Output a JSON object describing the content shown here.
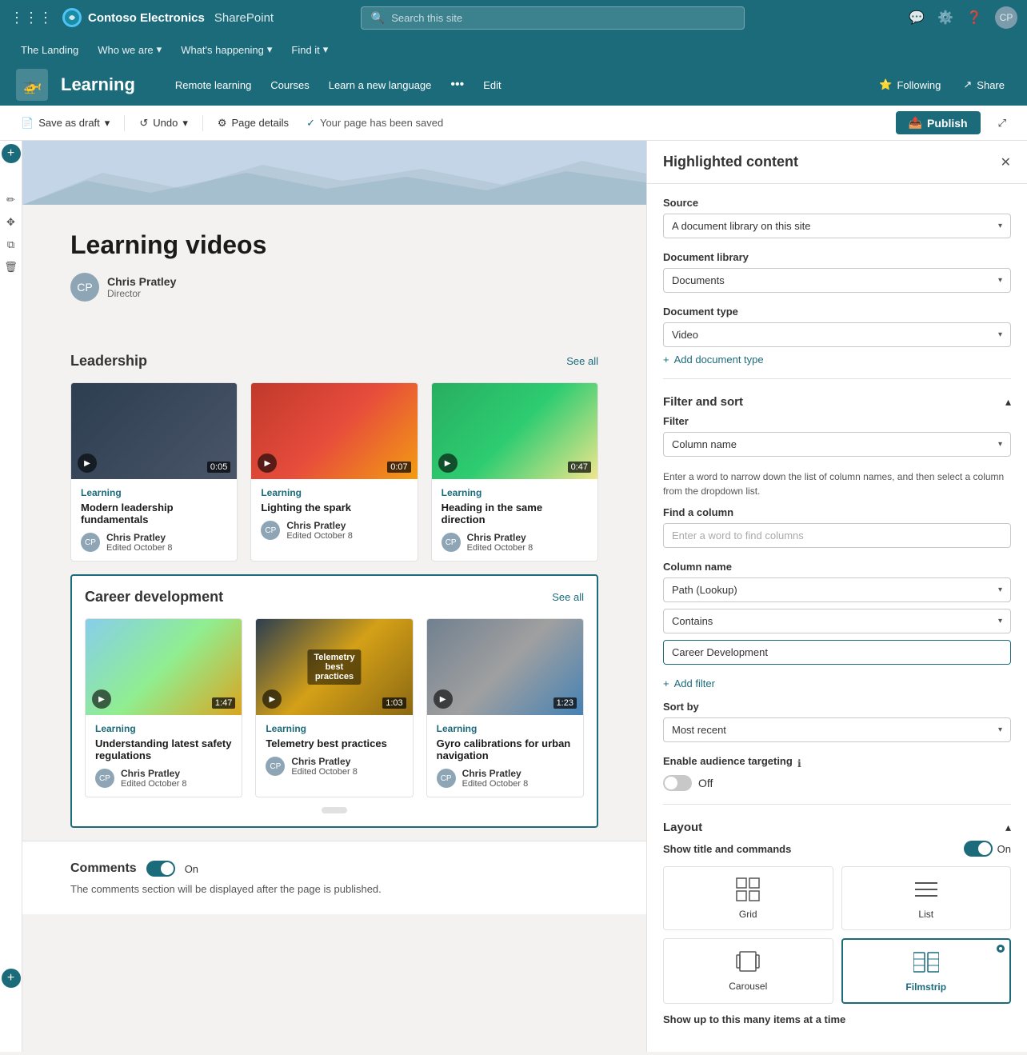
{
  "topNav": {
    "appLauncherIcon": "⋮⋮⋮",
    "brandName": "Contoso Electronics",
    "productName": "SharePoint",
    "searchPlaceholder": "Search this site",
    "icons": [
      "speech-bubble",
      "gear",
      "help",
      "avatar"
    ]
  },
  "secondaryNav": {
    "items": [
      {
        "label": "The Landing",
        "hasDropdown": false
      },
      {
        "label": "Who we are",
        "hasDropdown": true
      },
      {
        "label": "What's happening",
        "hasDropdown": true
      },
      {
        "label": "Find it",
        "hasDropdown": true
      }
    ]
  },
  "pageHeader": {
    "iconEmoji": "🚁",
    "title": "Learning",
    "navItems": [
      "Remote learning",
      "Courses",
      "Learn a new language"
    ],
    "moreIcon": "•••",
    "editLabel": "Edit",
    "followingLabel": "Following",
    "shareLabel": "Share"
  },
  "toolbar": {
    "saveDraftLabel": "Save as draft",
    "undoLabel": "Undo",
    "pageDetailsLabel": "Page details",
    "statusMessage": "Your page has been saved",
    "publishLabel": "Publish",
    "expandIcon": "⤢"
  },
  "mainContent": {
    "pageTitle": "Learning videos",
    "author": {
      "name": "Chris Pratley",
      "title": "Director",
      "initials": "CP"
    },
    "sections": [
      {
        "id": "leadership",
        "title": "Leadership",
        "seeAll": "See all",
        "videos": [
          {
            "tag": "Learning",
            "title": "Modern leadership fundamentals",
            "author": "Chris Pratley",
            "edited": "Edited October 8",
            "duration": "0:05",
            "thumbClass": "thumb-dark"
          },
          {
            "tag": "Learning",
            "title": "Lighting the spark",
            "author": "Chris Pratley",
            "edited": "Edited October 8",
            "duration": "0:07",
            "thumbClass": "thumb-fire"
          },
          {
            "tag": "Learning",
            "title": "Heading in the same direction",
            "author": "Chris Pratley",
            "edited": "Edited October 8",
            "duration": "0:47",
            "thumbClass": "thumb-office"
          }
        ]
      },
      {
        "id": "career",
        "title": "Career development",
        "seeAll": "See all",
        "videos": [
          {
            "tag": "Learning",
            "title": "Understanding latest safety regulations",
            "author": "Chris Pratley",
            "edited": "Edited October 8",
            "duration": "1:47",
            "thumbClass": "thumb-drone"
          },
          {
            "tag": "Learning",
            "title": "Telemetry best practices",
            "author": "Chris Pratley",
            "edited": "Edited October 8",
            "duration": "1:03",
            "thumbClass": "thumb-telemetry"
          },
          {
            "tag": "Learning",
            "title": "Gyro calibrations for urban navigation",
            "author": "Chris Pratley",
            "edited": "Edited October 8",
            "duration": "1:23",
            "thumbClass": "thumb-gyro"
          }
        ]
      }
    ],
    "comments": {
      "title": "Comments",
      "toggleState": "On",
      "description": "The comments section will be displayed after the page is published."
    }
  },
  "rightPanel": {
    "title": "Highlighted content",
    "source": {
      "label": "Source",
      "value": "A document library on this site"
    },
    "documentLibrary": {
      "label": "Document library",
      "value": "Documents"
    },
    "documentType": {
      "label": "Document type",
      "value": "Video"
    },
    "addDocumentType": "+ Add document type",
    "filterSort": {
      "title": "Filter and sort",
      "filterLabel": "Filter",
      "filterValue": "Column name",
      "filterInfo": "Enter a word to narrow down the list of column names, and then select a column from the dropdown list.",
      "findColumnLabel": "Find a column",
      "findColumnPlaceholder": "Enter a word to find columns",
      "columnNameLabel": "Column name",
      "columnNameValue": "Path (Lookup)",
      "conditionValue": "Contains",
      "filterTermValue": "Career Development",
      "addFilter": "+ Add filter",
      "sortByLabel": "Sort by",
      "sortByValue": "Most recent",
      "audienceTargetingLabel": "Enable audience targeting",
      "audienceTargetingState": "Off"
    },
    "layout": {
      "title": "Layout",
      "showTitleLabel": "Show title and commands",
      "showTitleState": "On",
      "options": [
        {
          "id": "grid",
          "label": "Grid",
          "icon": "⊞",
          "selected": false
        },
        {
          "id": "list",
          "label": "List",
          "icon": "≡",
          "selected": false
        },
        {
          "id": "carousel",
          "label": "Carousel",
          "icon": "⊡",
          "selected": false
        },
        {
          "id": "filmstrip",
          "label": "Filmstrip",
          "icon": "⊟",
          "selected": true
        }
      ],
      "showItemsLabel": "Show up to this many items at a time"
    }
  }
}
